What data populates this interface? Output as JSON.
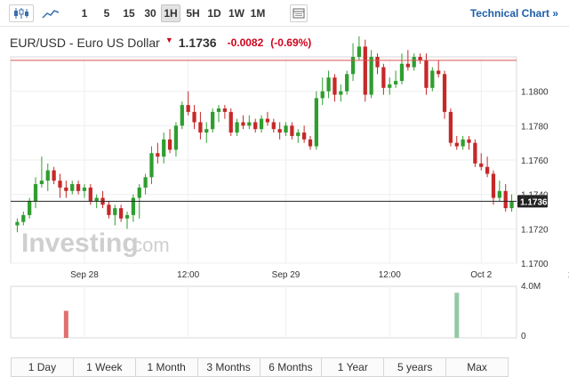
{
  "toolbar": {
    "chart_icons": [
      "candlestick-icon",
      "line-chart-icon",
      "settings-icon"
    ],
    "intervals": [
      {
        "label": "1",
        "active": false
      },
      {
        "label": "5",
        "active": false
      },
      {
        "label": "15",
        "active": false
      },
      {
        "label": "30",
        "active": false
      },
      {
        "label": "1H",
        "active": true
      },
      {
        "label": "5H",
        "active": false
      },
      {
        "label": "1D",
        "active": false
      },
      {
        "label": "1W",
        "active": false
      },
      {
        "label": "1M",
        "active": false
      }
    ],
    "technical_link": "Technical Chart »"
  },
  "header": {
    "title": "EUR/USD - Euro US Dollar",
    "direction_icon": "down-arrow-icon",
    "price": "1.1736",
    "change": "-0.0082",
    "change_pct": "(-0.69%)"
  },
  "watermark": {
    "brand": "Investing",
    "suffix": ".com"
  },
  "ranges": [
    "1 Day",
    "1 Week",
    "1 Month",
    "3 Months",
    "6 Months",
    "1 Year",
    "5 years",
    "Max"
  ],
  "colors": {
    "up": "#2f9e2f",
    "down": "#c62828",
    "ref_line": "#d9534f",
    "vol_up": "#93c9a3",
    "vol_down": "#e07070"
  },
  "chart_data": {
    "type": "candlestick",
    "y_ticks": [
      "1.1800",
      "1.1780",
      "1.1760",
      "1.1740",
      "1.1720",
      "1.1700"
    ],
    "ylim": [
      1.17,
      1.182
    ],
    "x_ticks": [
      {
        "label": "Sep 28",
        "index": 11
      },
      {
        "label": "12:00",
        "index": 28
      },
      {
        "label": "Sep 29",
        "index": 44
      },
      {
        "label": "12:00",
        "index": 61
      },
      {
        "label": "Oct 2",
        "index": 76
      },
      {
        "label": "12:00",
        "index": 92
      }
    ],
    "last_price": 1.1736,
    "reference_price": 1.1818,
    "volume_ticks": [
      "4.0M",
      "0"
    ],
    "volume_max": 4.0,
    "volume_bars": [
      {
        "index": 8,
        "value": 2.1,
        "dir": "down"
      },
      {
        "index": 72,
        "value": 3.5,
        "dir": "up"
      }
    ],
    "candles": [
      [
        1.1722,
        1.1726,
        1.1718,
        1.1724
      ],
      [
        1.1724,
        1.173,
        1.1722,
        1.1728
      ],
      [
        1.1728,
        1.1738,
        1.1726,
        1.1736
      ],
      [
        1.1736,
        1.175,
        1.1732,
        1.1746
      ],
      [
        1.1746,
        1.1762,
        1.1744,
        1.1748
      ],
      [
        1.1748,
        1.1758,
        1.1742,
        1.1754
      ],
      [
        1.1754,
        1.1756,
        1.1746,
        1.1748
      ],
      [
        1.1748,
        1.1752,
        1.1738,
        1.1744
      ],
      [
        1.1744,
        1.1748,
        1.1738,
        1.1742
      ],
      [
        1.1742,
        1.1748,
        1.174,
        1.1746
      ],
      [
        1.1746,
        1.1748,
        1.174,
        1.1742
      ],
      [
        1.1742,
        1.1746,
        1.1738,
        1.1744
      ],
      [
        1.1744,
        1.1746,
        1.1734,
        1.1736
      ],
      [
        1.1736,
        1.174,
        1.1732,
        1.1738
      ],
      [
        1.1738,
        1.1742,
        1.1732,
        1.1734
      ],
      [
        1.1734,
        1.1736,
        1.1726,
        1.1728
      ],
      [
        1.1728,
        1.1734,
        1.1722,
        1.1732
      ],
      [
        1.1732,
        1.1734,
        1.1724,
        1.1726
      ],
      [
        1.1726,
        1.173,
        1.172,
        1.1728
      ],
      [
        1.1728,
        1.174,
        1.1724,
        1.1738
      ],
      [
        1.1738,
        1.1746,
        1.1726,
        1.1744
      ],
      [
        1.1744,
        1.1752,
        1.174,
        1.175
      ],
      [
        1.175,
        1.1768,
        1.1746,
        1.1764
      ],
      [
        1.1764,
        1.177,
        1.1758,
        1.1762
      ],
      [
        1.1762,
        1.1776,
        1.1758,
        1.1772
      ],
      [
        1.1772,
        1.1778,
        1.1764,
        1.1766
      ],
      [
        1.1766,
        1.1782,
        1.1762,
        1.178
      ],
      [
        1.178,
        1.1794,
        1.1778,
        1.1792
      ],
      [
        1.1792,
        1.18,
        1.1786,
        1.1788
      ],
      [
        1.1788,
        1.1792,
        1.1778,
        1.1782
      ],
      [
        1.1782,
        1.1788,
        1.1772,
        1.1776
      ],
      [
        1.1776,
        1.1782,
        1.177,
        1.1778
      ],
      [
        1.1778,
        1.179,
        1.1776,
        1.1788
      ],
      [
        1.1788,
        1.1792,
        1.1782,
        1.179
      ],
      [
        1.179,
        1.1792,
        1.1784,
        1.1788
      ],
      [
        1.1788,
        1.179,
        1.1774,
        1.1776
      ],
      [
        1.1776,
        1.1784,
        1.1774,
        1.1782
      ],
      [
        1.1782,
        1.1786,
        1.1778,
        1.178
      ],
      [
        1.178,
        1.1786,
        1.1778,
        1.1782
      ],
      [
        1.1782,
        1.1784,
        1.1776,
        1.1778
      ],
      [
        1.1778,
        1.1786,
        1.1776,
        1.1784
      ],
      [
        1.1784,
        1.1788,
        1.178,
        1.1782
      ],
      [
        1.1782,
        1.1784,
        1.1776,
        1.1778
      ],
      [
        1.1778,
        1.1782,
        1.1772,
        1.1776
      ],
      [
        1.1776,
        1.1782,
        1.1774,
        1.178
      ],
      [
        1.178,
        1.1782,
        1.1772,
        1.1774
      ],
      [
        1.1774,
        1.1778,
        1.177,
        1.1776
      ],
      [
        1.1776,
        1.178,
        1.177,
        1.1772
      ],
      [
        1.1772,
        1.1774,
        1.1766,
        1.1768
      ],
      [
        1.1768,
        1.18,
        1.1766,
        1.1796
      ],
      [
        1.1796,
        1.1808,
        1.1792,
        1.18
      ],
      [
        1.18,
        1.1812,
        1.1796,
        1.1808
      ],
      [
        1.1808,
        1.181,
        1.1794,
        1.1798
      ],
      [
        1.1798,
        1.1804,
        1.1794,
        1.18
      ],
      [
        1.18,
        1.1812,
        1.1798,
        1.181
      ],
      [
        1.181,
        1.1828,
        1.1806,
        1.182
      ],
      [
        1.182,
        1.1832,
        1.1818,
        1.1826
      ],
      [
        1.1826,
        1.183,
        1.1794,
        1.1798
      ],
      [
        1.1798,
        1.1824,
        1.1796,
        1.182
      ],
      [
        1.182,
        1.1822,
        1.181,
        1.1814
      ],
      [
        1.1814,
        1.1816,
        1.1798,
        1.1802
      ],
      [
        1.1802,
        1.1808,
        1.1798,
        1.1804
      ],
      [
        1.1804,
        1.1812,
        1.1802,
        1.1806
      ],
      [
        1.1806,
        1.1822,
        1.1804,
        1.1816
      ],
      [
        1.1816,
        1.1824,
        1.1812,
        1.1814
      ],
      [
        1.1814,
        1.1822,
        1.1812,
        1.182
      ],
      [
        1.182,
        1.1822,
        1.1816,
        1.1818
      ],
      [
        1.1818,
        1.1822,
        1.1798,
        1.1802
      ],
      [
        1.1802,
        1.1814,
        1.18,
        1.1812
      ],
      [
        1.1812,
        1.1818,
        1.1808,
        1.181
      ],
      [
        1.181,
        1.1812,
        1.1784,
        1.1788
      ],
      [
        1.1788,
        1.179,
        1.1768,
        1.177
      ],
      [
        1.177,
        1.1774,
        1.1766,
        1.1768
      ],
      [
        1.1768,
        1.1774,
        1.1766,
        1.1772
      ],
      [
        1.1772,
        1.1774,
        1.1766,
        1.177
      ],
      [
        1.177,
        1.1772,
        1.1756,
        1.1758
      ],
      [
        1.1758,
        1.1764,
        1.1754,
        1.1756
      ],
      [
        1.1756,
        1.1762,
        1.175,
        1.1752
      ],
      [
        1.1752,
        1.1754,
        1.1734,
        1.1738
      ],
      [
        1.1738,
        1.1748,
        1.1736,
        1.1742
      ],
      [
        1.1742,
        1.1746,
        1.173,
        1.1732
      ],
      [
        1.1732,
        1.174,
        1.173,
        1.1736
      ]
    ]
  }
}
